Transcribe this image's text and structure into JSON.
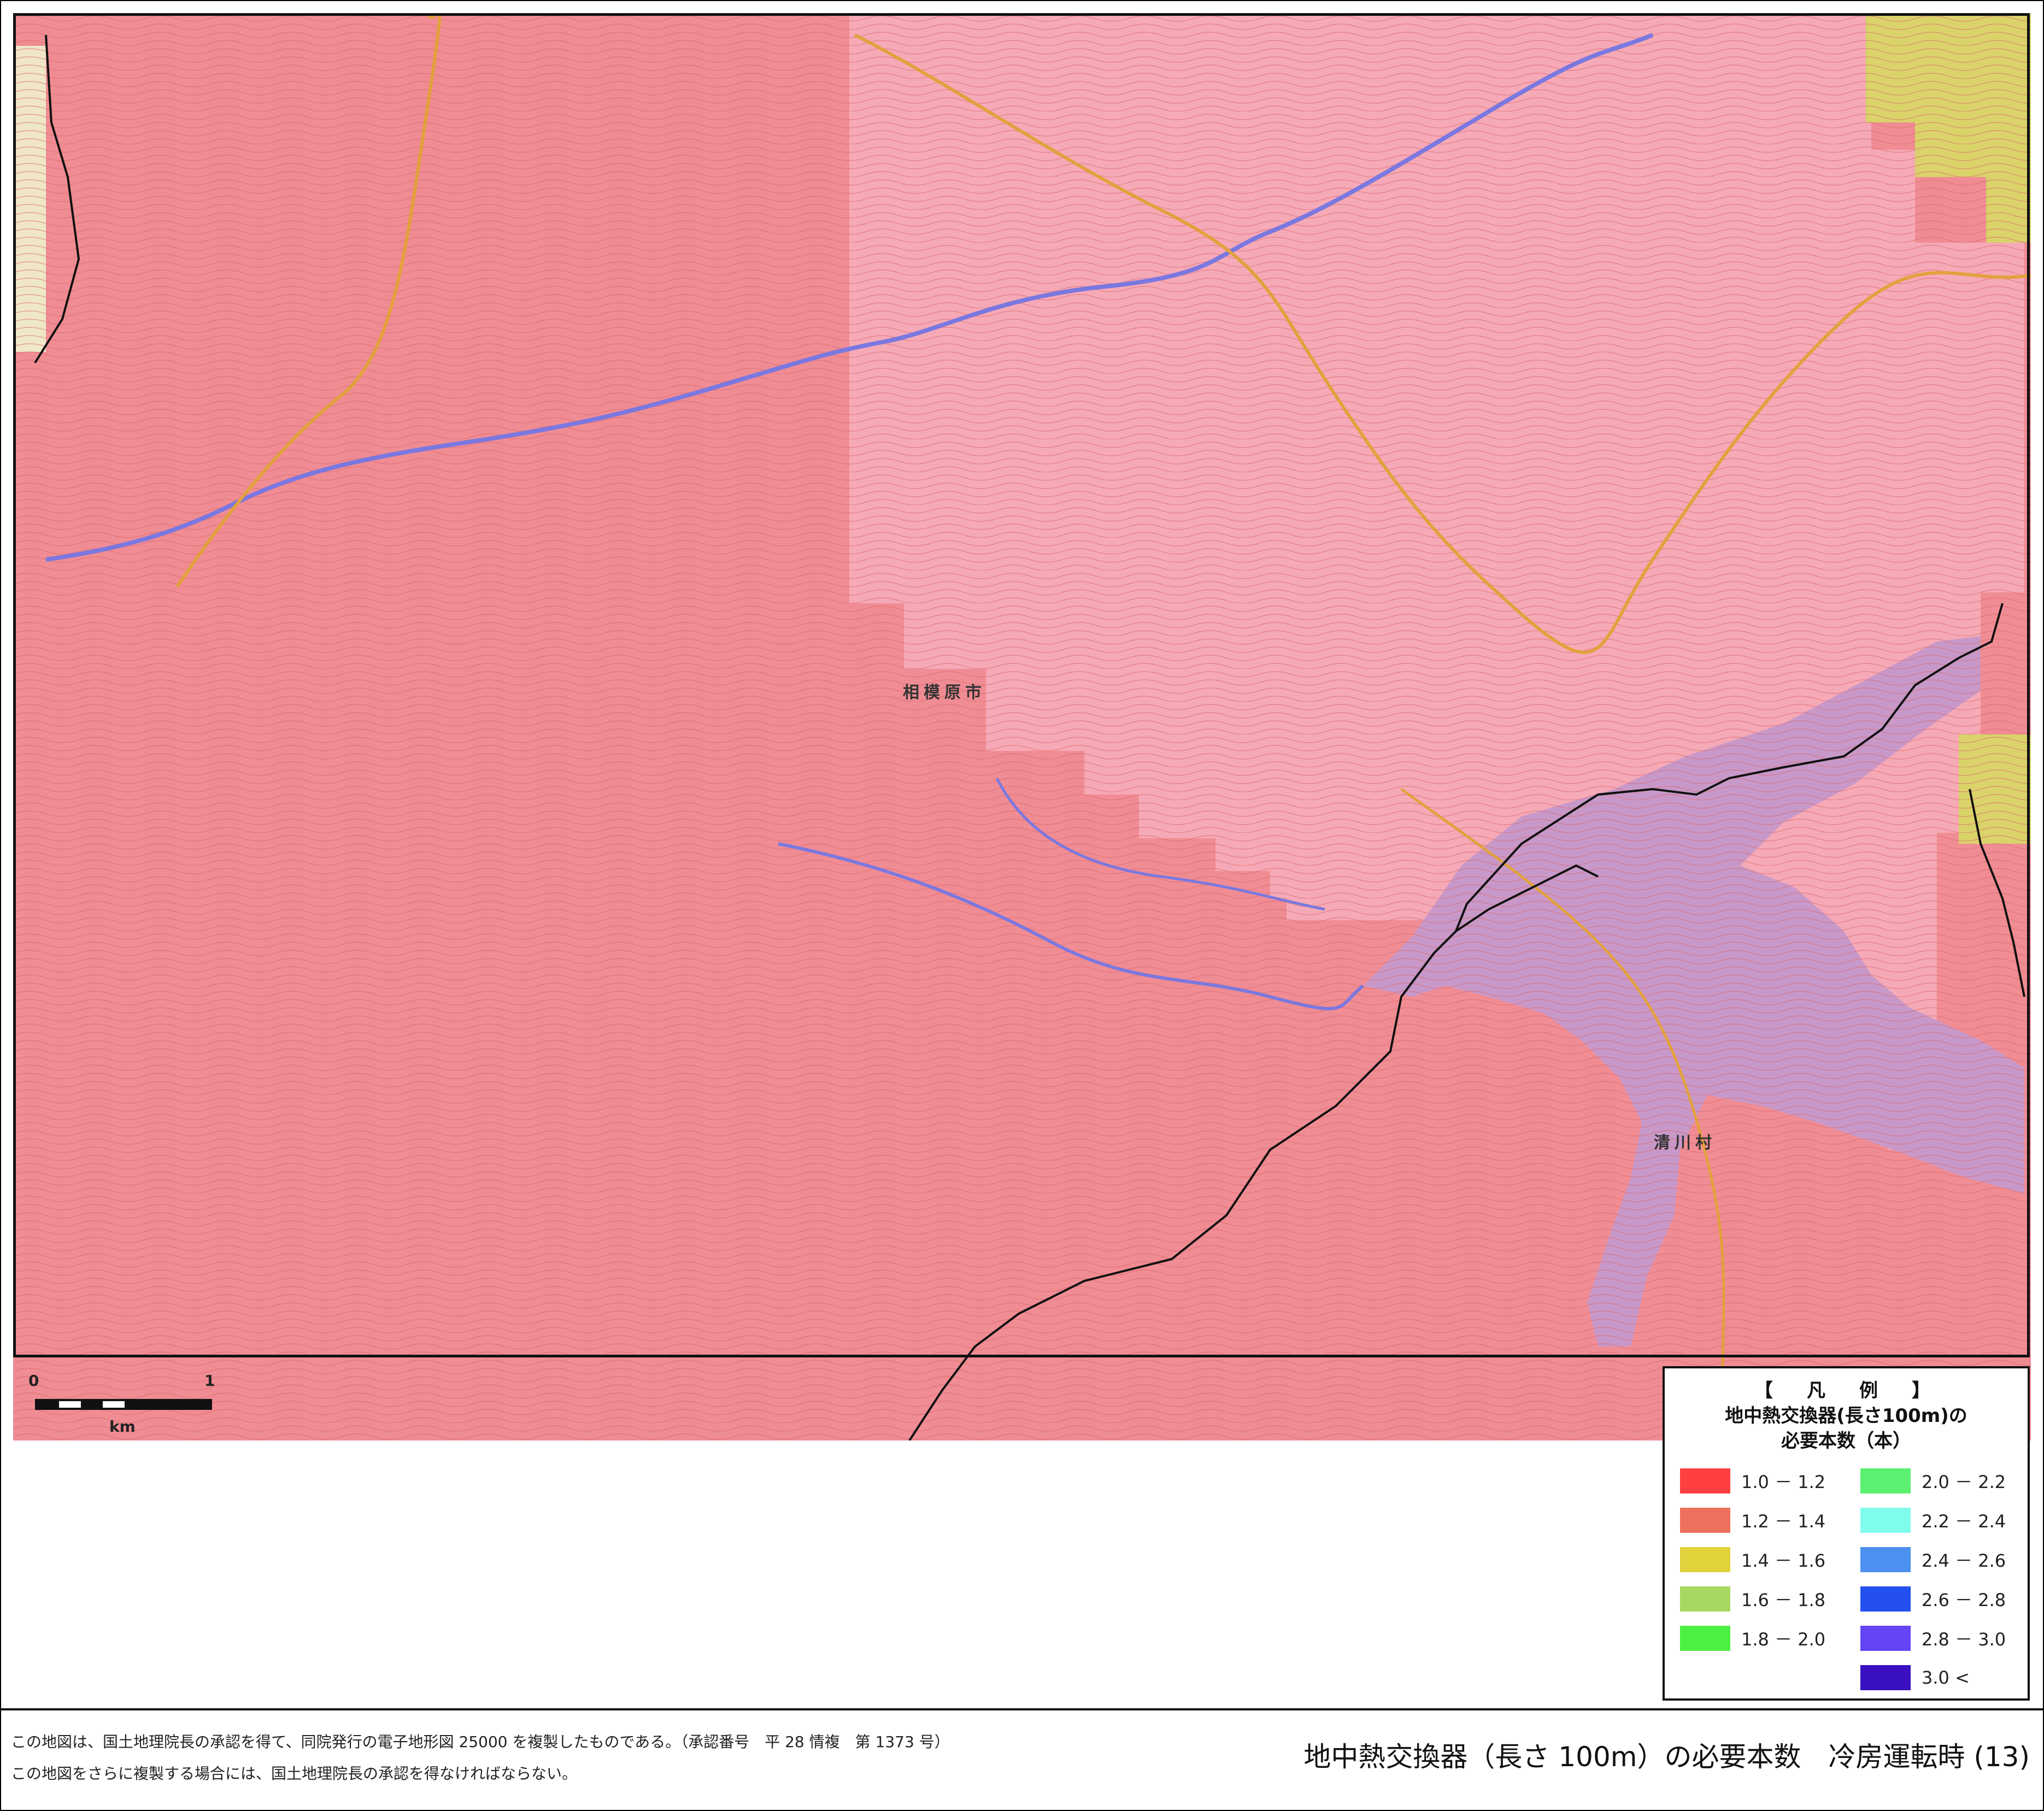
{
  "map": {
    "place_labels": {
      "sagamihara": "相模原市",
      "kiyokawa": "清川村"
    },
    "colors": {
      "base_pink": "#f08c93",
      "light_pink": "#f6a9b6",
      "lake_violet": "#c898c8",
      "yellow_zone": "#d9d36a",
      "pale_zone": "#efe7c8",
      "contour": "#d9666a",
      "river": "#7a78e0",
      "road": "#e2a13c",
      "boundary": "#111111"
    }
  },
  "scale_bar": {
    "label_start": "0",
    "label_end": "1",
    "unit": "km"
  },
  "legend": {
    "header": "【　凡　例　】",
    "title_line1": "地中熱交換器(長さ100m)の",
    "title_line2": "必要本数（本）",
    "items": [
      {
        "range": "1.0 － 1.2",
        "color": "#ff4040"
      },
      {
        "range": "1.2 － 1.4",
        "color": "#ed705e"
      },
      {
        "range": "1.4 － 1.6",
        "color": "#e2d23c"
      },
      {
        "range": "1.6 － 1.8",
        "color": "#a8d860"
      },
      {
        "range": "1.8 － 2.0",
        "color": "#4cf040"
      },
      {
        "range": "2.0 － 2.2",
        "color": "#5cf070"
      },
      {
        "range": "2.2 － 2.4",
        "color": "#80fcec"
      },
      {
        "range": "2.4 － 2.6",
        "color": "#4c90f0"
      },
      {
        "range": "2.6 － 2.8",
        "color": "#2450f0"
      },
      {
        "range": "2.8 － 3.0",
        "color": "#6444f4"
      },
      {
        "range": "3.0 <",
        "color": "#3a10c0"
      }
    ]
  },
  "footer": {
    "note_line1": "この地図は、国土地理院長の承認を得て、同院発行の電子地形図 25000 を複製したものである。（承認番号　平 28 情複　第 1373 号）",
    "note_line2": "この地図をさらに複製する場合には、国土地理院長の承認を得なければならない。",
    "title": "地中熱交換器（長さ 100m）の必要本数　冷房運転時 (13)"
  }
}
